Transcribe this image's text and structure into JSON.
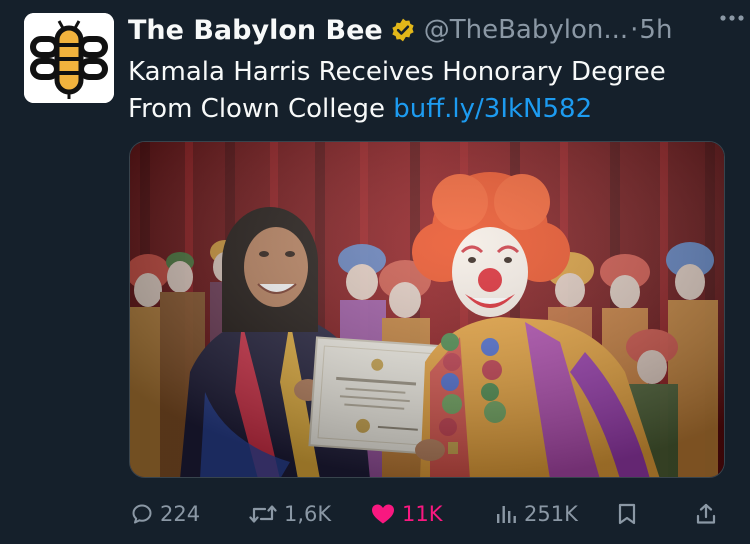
{
  "tweet": {
    "display_name": "The Babylon Bee",
    "handle": "@TheBabylon...",
    "separator": "·",
    "time": "5h",
    "text": "Kamala Harris Receives Honorary Degree From Clown College ",
    "link": "buff.ly/3IkN582",
    "media": {
      "certificate_seal_color": "#c9a34a"
    }
  },
  "actions": {
    "replies": "224",
    "reposts": "1,6K",
    "likes": "11K",
    "views": "251K"
  },
  "colors": {
    "background": "#15202b",
    "text_primary": "#f7f9f9",
    "text_secondary": "#8b98a5",
    "link": "#1d9bf0",
    "like": "#f91880",
    "verified_gold": "#e2b719"
  }
}
